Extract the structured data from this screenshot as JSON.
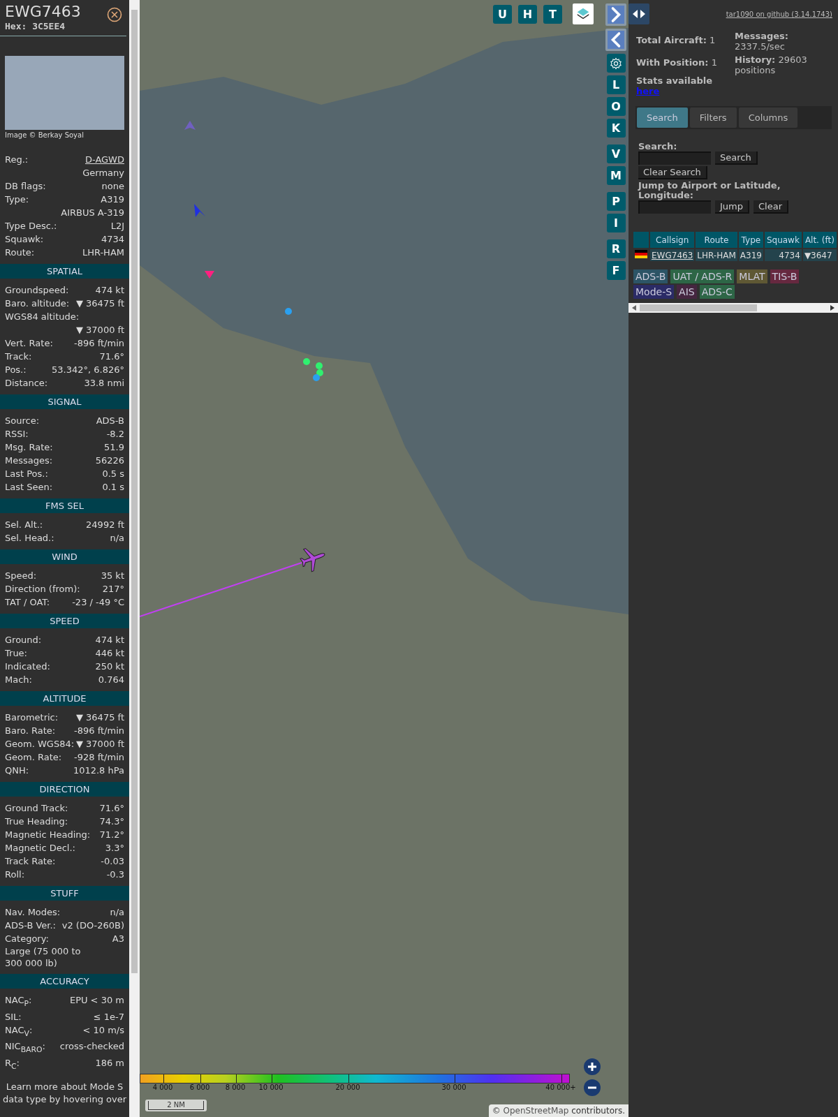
{
  "aircraft_panel": {
    "callsign": "EWG7463",
    "hex": "Hex: 3C5EE4",
    "photo_credit": "Image © Berkay Soyal",
    "details": [
      {
        "label": "Reg.:",
        "value": "D-AGWD",
        "kind": "link"
      },
      {
        "value": "Germany",
        "kind": "value_only"
      },
      {
        "label": "DB flags:",
        "value": "none",
        "kind": "plain"
      },
      {
        "label": "Type:",
        "value": "A319",
        "kind": "plain"
      },
      {
        "value": "AIRBUS A-319",
        "kind": "value_only"
      },
      {
        "label": "Type Desc.:",
        "value": "L2J",
        "kind": "plain"
      },
      {
        "label": "Squawk:",
        "value": "4734",
        "kind": "plain"
      },
      {
        "label": "Route:",
        "value": "LHR-HAM",
        "kind": "plain"
      }
    ],
    "sections": [
      {
        "title": "SPATIAL",
        "rows": [
          {
            "label": "Groundspeed:",
            "value": "474 kt",
            "kind": "plain"
          },
          {
            "label": "Baro. altitude:",
            "value": "▼ 36475 ft",
            "kind": "plain"
          },
          {
            "label": "WGS84 altitude:",
            "value": "▼ 37000 ft",
            "kind": "wrapped"
          },
          {
            "label": "Vert. Rate:",
            "value": "-896 ft/min",
            "kind": "plain"
          },
          {
            "label": "Track:",
            "value": "71.6°",
            "kind": "plain"
          },
          {
            "label": "Pos.:",
            "value": "53.342°, 6.826°",
            "kind": "plain"
          },
          {
            "label": "Distance:",
            "value": "33.8 nmi",
            "kind": "plain"
          }
        ]
      },
      {
        "title": "SIGNAL",
        "rows": [
          {
            "label": "Source:",
            "value": "ADS-B",
            "kind": "plain"
          },
          {
            "label": "RSSI:",
            "value": "-8.2",
            "kind": "plain"
          },
          {
            "label": "Msg. Rate:",
            "value": "51.9",
            "kind": "plain"
          },
          {
            "label": "Messages:",
            "value": "56226",
            "kind": "plain"
          },
          {
            "label": "Last Pos.:",
            "value": "0.5 s",
            "kind": "plain"
          },
          {
            "label": "Last Seen:",
            "value": "0.1 s",
            "kind": "plain"
          }
        ]
      },
      {
        "title": "FMS SEL",
        "rows": [
          {
            "label": "Sel. Alt.:",
            "value": "24992 ft",
            "kind": "plain"
          },
          {
            "label": "Sel. Head.:",
            "value": "n/a",
            "kind": "plain"
          }
        ]
      },
      {
        "title": "WIND",
        "rows": [
          {
            "label": "Speed:",
            "value": "35 kt",
            "kind": "plain"
          },
          {
            "label": "Direction (from):",
            "value": "217°",
            "kind": "plain"
          },
          {
            "label": "TAT / OAT:",
            "value": "-23 / -49 °C",
            "kind": "plain"
          }
        ]
      },
      {
        "title": "SPEED",
        "rows": [
          {
            "label": "Ground:",
            "value": "474 kt",
            "kind": "plain"
          },
          {
            "label": "True:",
            "value": "446 kt",
            "kind": "plain"
          },
          {
            "label": "Indicated:",
            "value": "250 kt",
            "kind": "plain"
          },
          {
            "label": "Mach:",
            "value": "0.764",
            "kind": "plain"
          }
        ]
      },
      {
        "title": "ALTITUDE",
        "rows": [
          {
            "label": "Barometric:",
            "value": "▼ 36475 ft",
            "kind": "plain"
          },
          {
            "label": "Baro. Rate:",
            "value": "-896 ft/min",
            "kind": "plain"
          },
          {
            "label": "Geom. WGS84:",
            "value": "▼ 37000 ft",
            "kind": "plain"
          },
          {
            "label": "Geom. Rate:",
            "value": "-928 ft/min",
            "kind": "plain"
          },
          {
            "label": "QNH:",
            "value": "1012.8 hPa",
            "kind": "plain"
          }
        ]
      },
      {
        "title": "DIRECTION",
        "rows": [
          {
            "label": "Ground Track:",
            "value": "71.6°",
            "kind": "plain"
          },
          {
            "label": "True Heading:",
            "value": "74.3°",
            "kind": "plain"
          },
          {
            "label": "Magnetic Heading:",
            "value": "71.2°",
            "kind": "plain"
          },
          {
            "label": "Magnetic Decl.:",
            "value": "3.3°",
            "kind": "plain"
          },
          {
            "label": "Track Rate:",
            "value": "-0.03",
            "kind": "plain"
          },
          {
            "label": "Roll:",
            "value": "-0.3",
            "kind": "plain"
          }
        ]
      },
      {
        "title": "STUFF",
        "rows": [
          {
            "label": "Nav. Modes:",
            "value": "n/a",
            "kind": "plain"
          },
          {
            "label": "ADS-B Ver.:",
            "value": "v2 (DO-260B)",
            "kind": "plain"
          },
          {
            "label": "Category:",
            "value": "A3",
            "kind": "plain"
          },
          {
            "label": "Large (75 000 to 300 000 lb)",
            "kind": "label_only"
          }
        ]
      },
      {
        "title": "ACCURACY",
        "rows": [
          {
            "label": "NAC$_{P}$:",
            "value": "EPU < 30 m",
            "kind": "plain"
          },
          {
            "label": "SIL:",
            "value": "≤ 1e-7",
            "kind": "plain"
          },
          {
            "label": "NAC$_{V}$:",
            "value": "< 10 m/s",
            "kind": "plain"
          },
          {
            "label": "NIC$_{BARO}$:",
            "value": "cross-checked",
            "kind": "plain"
          },
          {
            "label": "R$_{C}$:",
            "value": "186 m",
            "kind": "plain"
          }
        ]
      }
    ],
    "footer": "Learn more about Mode S data type by hovering over"
  },
  "map": {
    "top_buttons": [
      "U",
      "H",
      "T"
    ],
    "side_button_groups": [
      [
        {
          "kind": "next"
        },
        {
          "kind": "prev"
        },
        {
          "kind": "settings"
        },
        {
          "kind": "letter",
          "label": "L"
        },
        {
          "kind": "letter",
          "label": "O"
        },
        {
          "kind": "letter",
          "label": "K"
        }
      ],
      [
        {
          "kind": "letter",
          "label": "V"
        },
        {
          "kind": "letter",
          "label": "M"
        }
      ],
      [
        {
          "kind": "letter",
          "label": "P"
        },
        {
          "kind": "letter",
          "label": "I"
        }
      ],
      [
        {
          "kind": "letter",
          "label": "R"
        },
        {
          "kind": "letter",
          "label": "F"
        }
      ]
    ],
    "altitude_legend": [
      "4 000",
      "6 000",
      "8 000",
      "10 000",
      "20 000",
      "30 000",
      "40 000+"
    ],
    "scale": "2 NM",
    "attribution": {
      "prefix": "©",
      "link": "OpenStreetMap",
      "suffix": "contributors."
    }
  },
  "right_panel": {
    "github_link": "tar1090 on github (3.14.1743)",
    "stats_left": [
      "**Total Aircraft:** 1",
      "**With Position:** 1"
    ],
    "stats_available": {
      "text": "Stats available",
      "link": "here"
    },
    "stats_right": [
      "**Messages:** 2337.5/sec",
      "**History:** 29603 positions"
    ],
    "tabs": [
      {
        "label": "Search",
        "selected": true
      },
      {
        "label": "Filters",
        "selected": false
      },
      {
        "label": "Columns",
        "selected": false
      }
    ],
    "search": {
      "label": "Search:",
      "button": "Search",
      "clear_button": "Clear Search"
    },
    "jump": {
      "label": "Jump to Airport or Latitude, Longitude:",
      "button": "Jump",
      "clear_button": "Clear"
    },
    "table": {
      "columns": [
        "Callsign",
        "Route",
        "Type",
        "Squawk",
        "Alt. (ft)"
      ],
      "rows": [
        {
          "callsign": "EWG7463",
          "route": "LHR-HAM",
          "type": "A319",
          "squawk": "4734",
          "altitude": "▼3647"
        }
      ]
    },
    "source_legend": [
      {
        "label": "ADS-B",
        "color": "#2c5466"
      },
      {
        "label": "UAT / ADS-R",
        "color": "#2d6646"
      },
      {
        "label": "MLAT",
        "color": "#5f5834"
      },
      {
        "label": "TIS-B",
        "color": "#66283f"
      },
      {
        "label": "Mode-S",
        "color": "#2b2b66"
      },
      {
        "label": "AIS",
        "color": "#452640"
      },
      {
        "label": "ADS-C",
        "color": "#2d6646"
      }
    ]
  }
}
